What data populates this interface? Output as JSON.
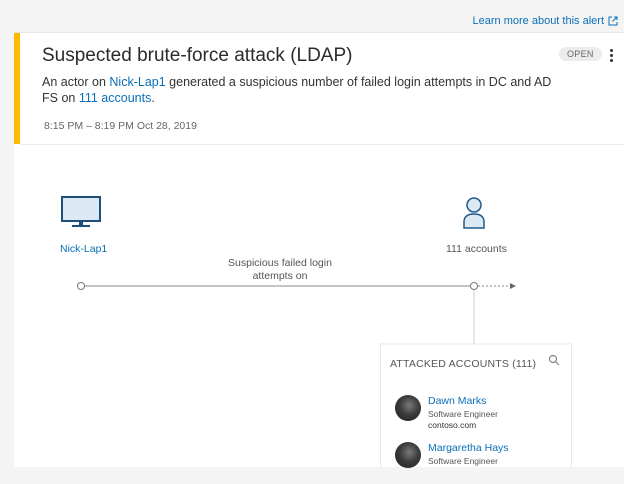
{
  "learn_more": "Learn more about this alert",
  "alert": {
    "title": "Suspected brute-force attack (LDAP)",
    "status": "OPEN",
    "description_prefix": "An actor on ",
    "source_link": "Nick-Lap1",
    "description_middle": " generated a suspicious number of failed login attempts in DC and AD FS on ",
    "accounts_link": "111 accounts",
    "description_suffix": ".",
    "time_range": "8:15 PM – 8:19 PM",
    "date": "Oct 28, 2019",
    "severity_color": "#ffb900"
  },
  "diagram": {
    "source_label": "Nick-Lap1",
    "target_label": "111 accounts",
    "connection_label": "Suspicious failed login attempts on",
    "source_icon": "monitor-icon",
    "target_icon": "person-icon"
  },
  "attacked_accounts": {
    "title": "ATTACKED ACCOUNTS (111)",
    "items": [
      {
        "name": "Dawn Marks",
        "role": "Software Engineer",
        "domain": "contoso.com"
      },
      {
        "name": "Margaretha Hays",
        "role": "Software Engineer",
        "domain": ""
      }
    ]
  },
  "colors": {
    "link": "#0a6fb8",
    "accent": "#ffb900",
    "icon_blue": "#1e5a8c"
  }
}
